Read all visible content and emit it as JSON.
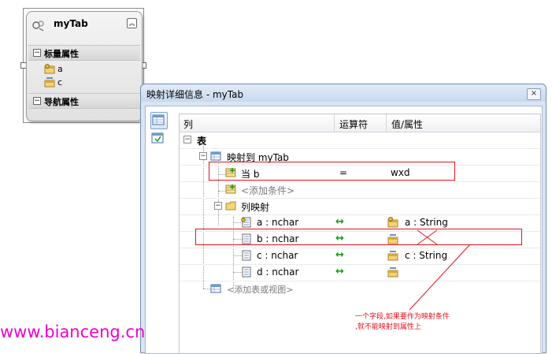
{
  "entity": {
    "title": "myTab",
    "sections": {
      "scalar": "标量属性",
      "navigation": "导航属性"
    },
    "properties": [
      "a",
      "c"
    ]
  },
  "window": {
    "title": "映射详细信息 - myTab",
    "close_icon": "×",
    "columns": {
      "col": "列",
      "op": "运算符",
      "val": "值/属性"
    },
    "tree": {
      "table_label": "表",
      "mapping": "映射到 myTab",
      "condition": {
        "col": "当 b",
        "op": "=",
        "val": "wxd"
      },
      "add_condition": "<添加条件>",
      "column_mapping": "列映射",
      "columns": [
        {
          "name": "a : nchar",
          "op": "↔",
          "val": "a : String"
        },
        {
          "name": "b : nchar",
          "op": "↔",
          "val": ""
        },
        {
          "name": "c : nchar",
          "op": "↔",
          "val": "c : String"
        },
        {
          "name": "d : nchar",
          "op": "↔",
          "val": ""
        }
      ],
      "add_table": "<添加表或视图>"
    }
  },
  "annotation": {
    "line1": "一个字段,如果要作为映射条件",
    "line2": ",就不能映射到属性上",
    "color": "#e0141e"
  },
  "watermark": "www.bianceng.cn"
}
